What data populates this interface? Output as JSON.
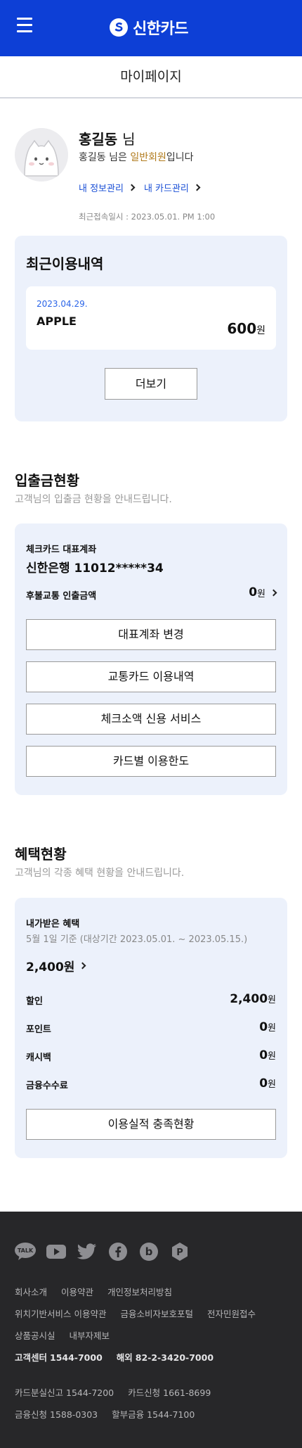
{
  "header": {
    "brand": "신한카드"
  },
  "page_title": "마이페이지",
  "profile": {
    "name": "홍길동",
    "name_suffix": "님",
    "desc_prefix": "홍길동 님은 ",
    "grade": "일반회원",
    "desc_suffix": "입니다",
    "link_info": "내 정보관리",
    "link_card": "내 카드관리",
    "last_login": "최근접속일시 : 2023.05.01. PM 1:00"
  },
  "recent": {
    "title": "최근이용내역",
    "date": "2023.04.29.",
    "merchant": "APPLE",
    "amount": "600",
    "unit": "원",
    "more": "더보기"
  },
  "deposit": {
    "title": "입출금현황",
    "subtitle": "고객님의 입출금 현황을 안내드립니다.",
    "account_label": "체크카드 대표계좌",
    "account_no": "신한은행 11012*****34",
    "transit_label": "후불교통 인출금액",
    "transit_value": "0",
    "unit": "원",
    "buttons": [
      "대표계좌 변경",
      "교통카드 이용내역",
      "체크소액 신용 서비스",
      "카드별 이용한도"
    ]
  },
  "benefit": {
    "title": "혜택현황",
    "subtitle": "고객님의 각종 혜택 현황을 안내드립니다.",
    "received_label": "내가받은 혜택",
    "period": "5월 1일 기준 (대상기간  2023.05.01. ~ 2023.05.15.)",
    "total": "2,400원",
    "rows": [
      {
        "label": "할인",
        "value": "2,400"
      },
      {
        "label": "포인트",
        "value": "0"
      },
      {
        "label": "캐시백",
        "value": "0"
      },
      {
        "label": "금융수수료",
        "value": "0"
      }
    ],
    "unit": "원",
    "button": "이용실적 충족현황"
  },
  "footer": {
    "links1": [
      "회사소개",
      "이용약관",
      "개인정보처리방침"
    ],
    "links2": [
      "위치기반서비스 이용약관",
      "금융소비자보호포털",
      "전자민원접수"
    ],
    "links3": [
      "상품공시실",
      "내부자제보"
    ],
    "center_label": "고객센터",
    "center_no": "1544-7000",
    "overseas_label": "해외",
    "overseas_no": "82-2-3420-7000",
    "lost_label": "카드분실신고",
    "lost_no": "1544-7200",
    "apply_label": "카드신청",
    "apply_no": "1661-8699",
    "finance_label": "금융신청",
    "finance_no": "1588-0303",
    "install_label": "할부금융",
    "install_no": "1544-7100"
  },
  "colors": {
    "brand": "#0d3fd6",
    "panel": "#ecf1fb",
    "link": "#1a4fd6",
    "grade": "#b07a1b",
    "footer": "#272729"
  }
}
